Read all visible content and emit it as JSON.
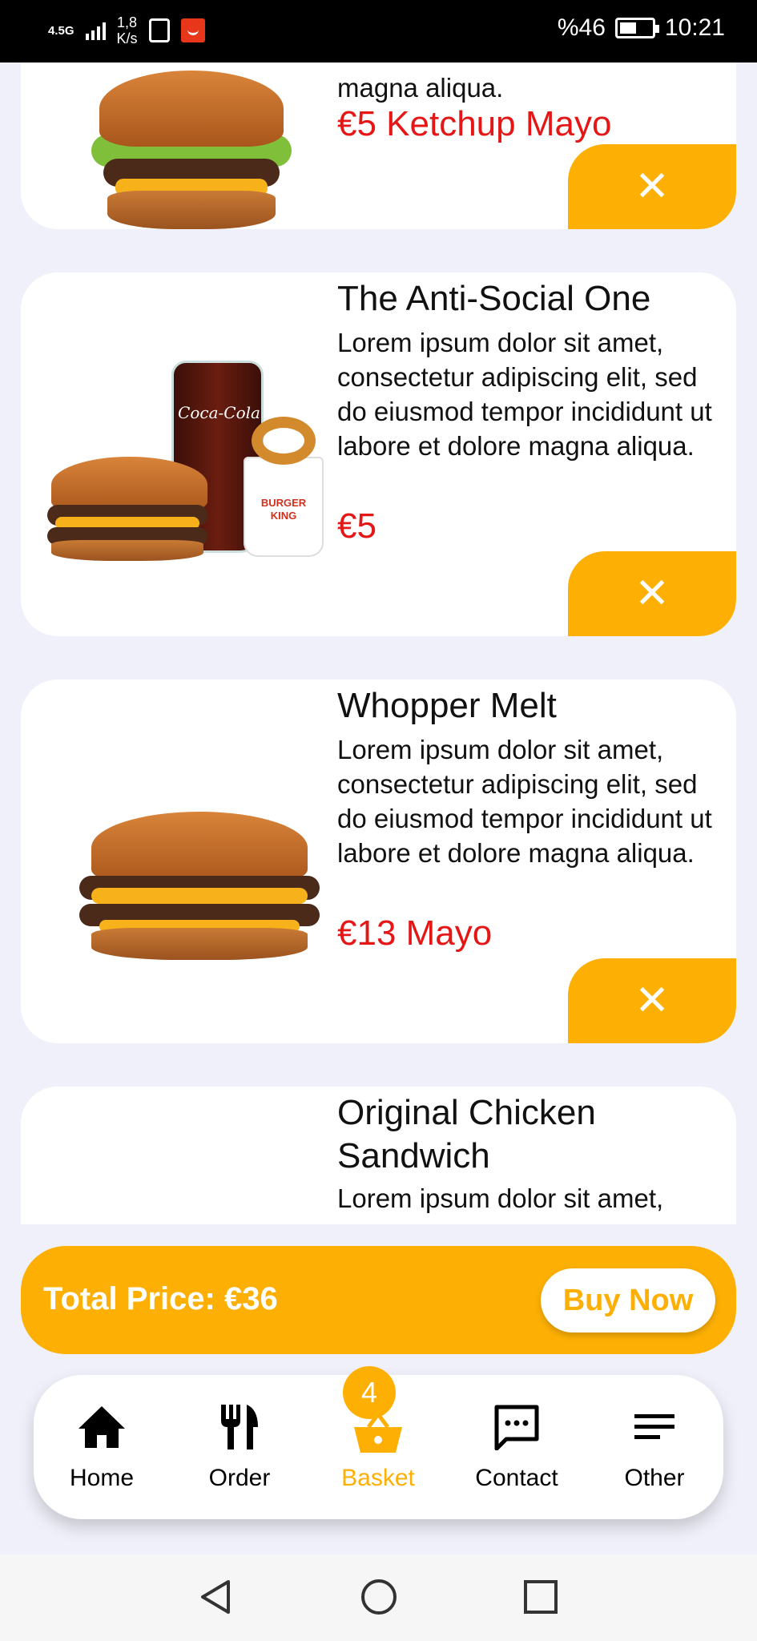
{
  "status_bar": {
    "network": "4.5G",
    "speed_value": "1,8",
    "speed_unit": "K/s",
    "battery": "%46",
    "time": "10:21"
  },
  "cart_items": [
    {
      "name": "",
      "description_tail": "magna aliqua.",
      "price": "€5 Ketchup Mayo"
    },
    {
      "name": "The Anti-Social One",
      "description": "Lorem ipsum dolor sit amet, consectetur adipiscing elit, sed do eiusmod tempor incididunt ut labore et dolore magna aliqua.",
      "price": "€5"
    },
    {
      "name": "Whopper Melt",
      "description": "Lorem ipsum dolor sit amet, consectetur adipiscing elit, sed do eiusmod tempor incididunt ut labore et dolore magna aliqua.",
      "price": "€13 Mayo"
    },
    {
      "name": "Original Chicken Sandwich",
      "description": "Lorem ipsum dolor sit amet,"
    }
  ],
  "remove_symbol": "✕",
  "total": {
    "label": "Total Price: €36",
    "buy_label": "Buy Now"
  },
  "nav": {
    "items": [
      {
        "label": "Home",
        "icon": "home-icon"
      },
      {
        "label": "Order",
        "icon": "cutlery-icon"
      },
      {
        "label": "Basket",
        "icon": "basket-icon"
      },
      {
        "label": "Contact",
        "icon": "chat-icon"
      },
      {
        "label": "Other",
        "icon": "menu-icon"
      }
    ],
    "active": "Basket",
    "basket_count": "4"
  },
  "images": {
    "cup_logo": "Coca-Cola",
    "fries_logo": "BURGER KING"
  },
  "colors": {
    "accent": "#fdb003",
    "price": "#e41616",
    "background": "#f0f0fa"
  }
}
